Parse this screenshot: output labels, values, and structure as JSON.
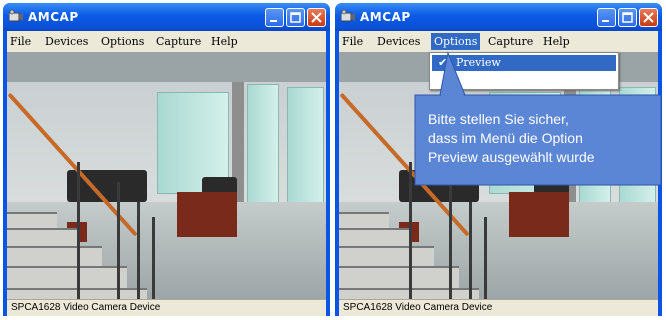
{
  "windows": [
    {
      "id": "left",
      "app_title": "AMCAP",
      "menu": [
        {
          "label": "File"
        },
        {
          "label": "Devices"
        },
        {
          "label": "Options"
        },
        {
          "label": "Capture"
        },
        {
          "label": "Help"
        }
      ],
      "status_text": "SPCA1628 Video Camera Device"
    },
    {
      "id": "right",
      "app_title": "AMCAP",
      "menu": [
        {
          "label": "File"
        },
        {
          "label": "Devices"
        },
        {
          "label": "Options"
        },
        {
          "label": "Capture"
        },
        {
          "label": "Help"
        }
      ],
      "open_menu": "Options",
      "dropdown_items": [
        {
          "label": "Preview",
          "checked": true
        }
      ],
      "status_text": "SPCA1628 Video Camera Device"
    }
  ],
  "callout": {
    "lines": [
      "Bitte stellen Sie sicher,",
      "dass im Menü die Option",
      "Preview ausgewählt wurde"
    ],
    "color": "#5b86d6"
  },
  "colors": {
    "titlebar": "#0b5ae6",
    "window_border": "#0a55e4",
    "menu_highlight": "#316ac5",
    "close_button": "#c83a10"
  }
}
